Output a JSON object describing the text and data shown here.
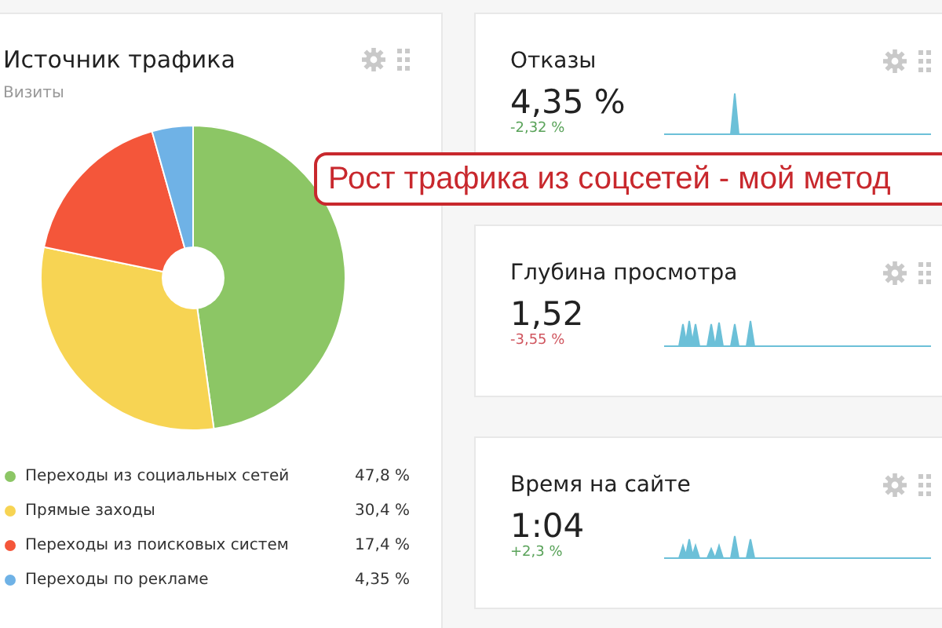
{
  "traffic_card": {
    "title": "Источник трафика",
    "subtitle": "Визиты",
    "chart_data": {
      "type": "donut",
      "categories": [
        "Переходы из социальных сетей",
        "Прямые заходы",
        "Переходы из поисковых систем",
        "Переходы по рекламе"
      ],
      "values": [
        47.8,
        30.4,
        17.4,
        4.35
      ]
    },
    "legend": [
      {
        "value": "47,8 %",
        "color": "#8cc665"
      },
      {
        "value": "30,4 %",
        "color": "#f7d453"
      },
      {
        "value": "17,4 %",
        "color": "#f4563a"
      },
      {
        "value": "4,35 %",
        "color": "#6fb2e6"
      }
    ]
  },
  "metric_cards": [
    {
      "title": "Отказы",
      "value": "4,35 %",
      "change": "-2,32 %",
      "positive": true
    },
    {
      "title": "Глубина просмотра",
      "value": "1,52",
      "change": "-3,55 %",
      "positive": false
    },
    {
      "title": "Время на сайте",
      "value": "1:04",
      "change": "+2,3 %",
      "positive": true
    }
  ],
  "banner": {
    "text": "Рост трафика из соцсетей - мой метод"
  }
}
